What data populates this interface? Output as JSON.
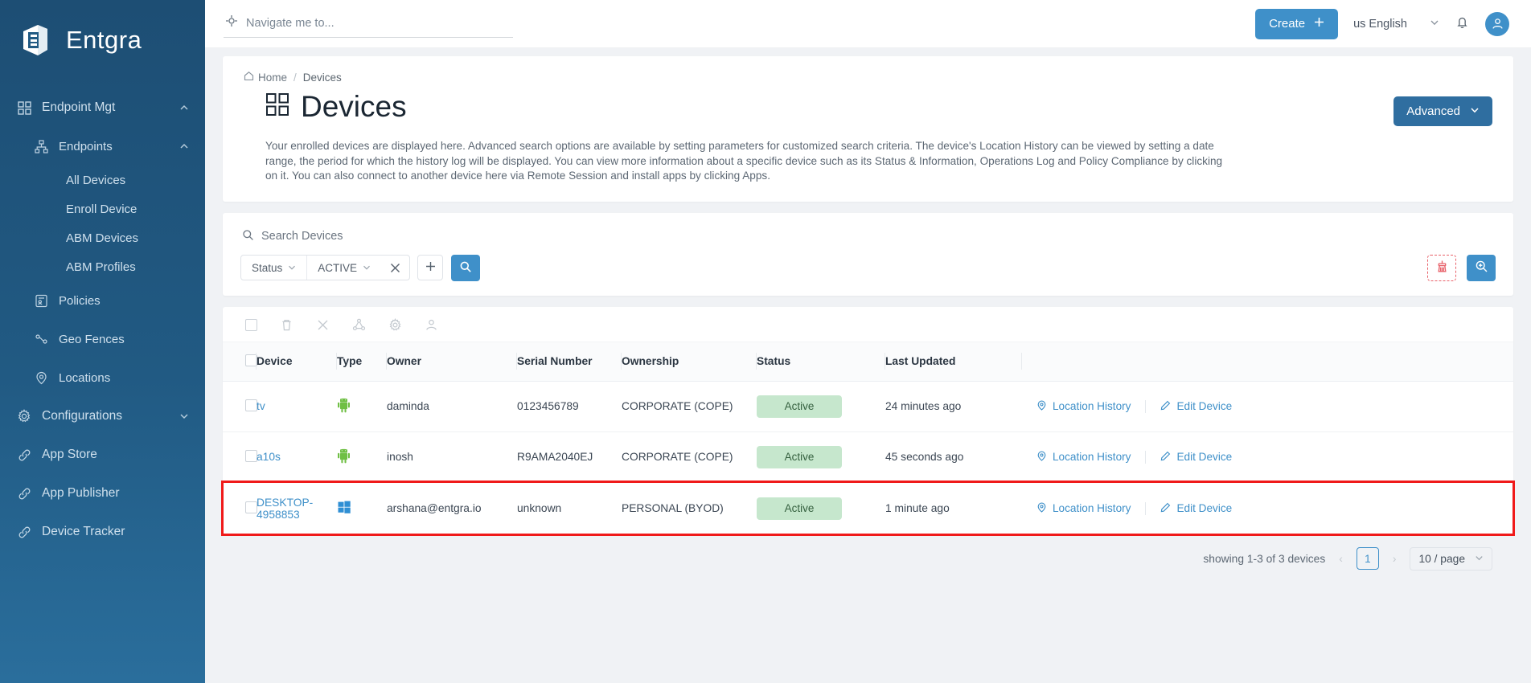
{
  "brand": {
    "name": "Entgra",
    "logo_icon": "entgra-logo-icon"
  },
  "sidebar": {
    "items": [
      {
        "label": "Endpoint Mgt",
        "icon": "grid-icon",
        "level": 0,
        "chevron": "chevron-up-icon"
      },
      {
        "label": "Endpoints",
        "icon": "sitemap-icon",
        "level": 1,
        "chevron": "chevron-up-icon"
      },
      {
        "label": "All Devices",
        "icon": "",
        "level": 2,
        "chevron": ""
      },
      {
        "label": "Enroll Device",
        "icon": "",
        "level": 2,
        "chevron": ""
      },
      {
        "label": "ABM Devices",
        "icon": "",
        "level": 2,
        "chevron": ""
      },
      {
        "label": "ABM Profiles",
        "icon": "",
        "level": 2,
        "chevron": ""
      },
      {
        "label": "Policies",
        "icon": "policy-icon",
        "level": 1,
        "chevron": ""
      },
      {
        "label": "Geo Fences",
        "icon": "geofence-icon",
        "level": 1,
        "chevron": ""
      },
      {
        "label": "Locations",
        "icon": "location-icon",
        "level": 1,
        "chevron": ""
      },
      {
        "label": "Configurations",
        "icon": "gear-icon",
        "level": 0,
        "chevron": "chevron-down-icon"
      },
      {
        "label": "App Store",
        "icon": "link-icon",
        "level": 0,
        "chevron": ""
      },
      {
        "label": "App Publisher",
        "icon": "link-icon",
        "level": 0,
        "chevron": ""
      },
      {
        "label": "Device Tracker",
        "icon": "link-icon",
        "level": 0,
        "chevron": ""
      }
    ]
  },
  "topbar": {
    "nav_search_placeholder": "Navigate me to...",
    "nav_search_value": "",
    "create_label": "Create",
    "language": "us English",
    "notification_icon": "bell-icon",
    "avatar_icon": "user-avatar-icon"
  },
  "breadcrumb": {
    "home": "Home",
    "separator": "/",
    "current": "Devices"
  },
  "page": {
    "title": "Devices",
    "title_icon": "grid-icon",
    "advanced_label": "Advanced",
    "description": "Your enrolled devices are displayed here. Advanced search options are available by setting parameters for customized search criteria. The device's Location History can be viewed by setting a date range, the period for which the history log will be displayed. You can view more information about a specific device such as its Status & Information, Operations Log and Policy Compliance by clicking on it. You can also connect to another device here via Remote Session and install apps by clicking Apps."
  },
  "search": {
    "label": "Search Devices",
    "filter": {
      "field": "Status",
      "value": "ACTIVE"
    },
    "add_label": "+",
    "search_icon": "search-icon",
    "clear_icon": "broom-clear-icon",
    "advanced_search_icon": "search-plus-icon"
  },
  "toolbar_icons": [
    "select-all-checkbox",
    "delete-icon",
    "cancel-icon",
    "share-group-icon",
    "gear-icon",
    "user-icon"
  ],
  "table": {
    "columns": [
      "Device",
      "Type",
      "Owner",
      "Serial Number",
      "Ownership",
      "Status",
      "Last Updated"
    ],
    "rows": [
      {
        "device": "tv",
        "type_icon": "android-icon",
        "owner": "daminda",
        "serial": "0123456789",
        "ownership": "CORPORATE (COPE)",
        "status": "Active",
        "last_updated": "24 minutes ago",
        "location_label": "Location History",
        "edit_label": "Edit Device",
        "highlighted": false
      },
      {
        "device": "a10s",
        "type_icon": "android-icon",
        "owner": "inosh",
        "serial": "R9AMA2040EJ",
        "ownership": "CORPORATE (COPE)",
        "status": "Active",
        "last_updated": "45 seconds ago",
        "location_label": "Location History",
        "edit_label": "Edit Device",
        "highlighted": false
      },
      {
        "device": "DESKTOP-4958853",
        "type_icon": "windows-icon",
        "owner": "arshana@entgra.io",
        "serial": "unknown",
        "ownership": "PERSONAL (BYOD)",
        "status": "Active",
        "last_updated": "1 minute ago",
        "location_label": "Location History",
        "edit_label": "Edit Device",
        "highlighted": true
      }
    ]
  },
  "pagination": {
    "summary": "showing 1-3 of 3 devices",
    "prev": "‹",
    "page": "1",
    "next": "›",
    "page_size": "10 / page"
  },
  "colors": {
    "sidebar": "#215a83",
    "accent": "#3f90c9",
    "advanced_button": "#2f6ea0",
    "status_badge_bg": "#c6e7cd",
    "status_badge_text": "#35603f",
    "highlight_outline": "#f01a1a",
    "android_green": "#6fbf44",
    "windows_blue": "#2f8fd4",
    "clear_red": "#e8626a"
  }
}
